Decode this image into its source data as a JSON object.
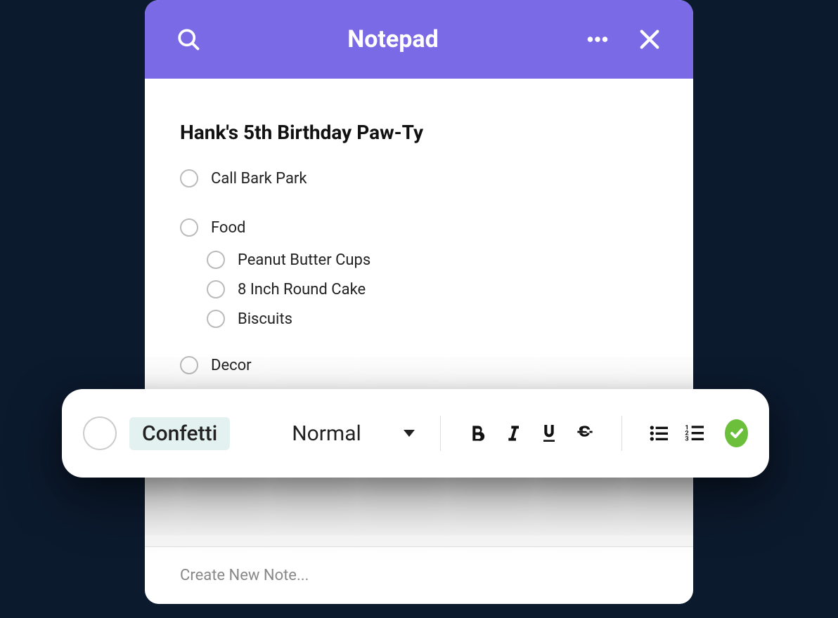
{
  "header": {
    "title": "Notepad"
  },
  "note": {
    "title": "Hank's 5th Birthday Paw-Ty",
    "items": [
      {
        "label": "Call Bark Park"
      },
      {
        "label": "Food"
      },
      {
        "label": "Peanut Butter Cups"
      },
      {
        "label": "8 Inch Round Cake"
      },
      {
        "label": "Biscuits"
      },
      {
        "label": "Decor"
      }
    ]
  },
  "toolbar": {
    "tag": "Confetti",
    "style_label": "Normal"
  },
  "footer": {
    "new_note_placeholder": "Create New Note..."
  }
}
